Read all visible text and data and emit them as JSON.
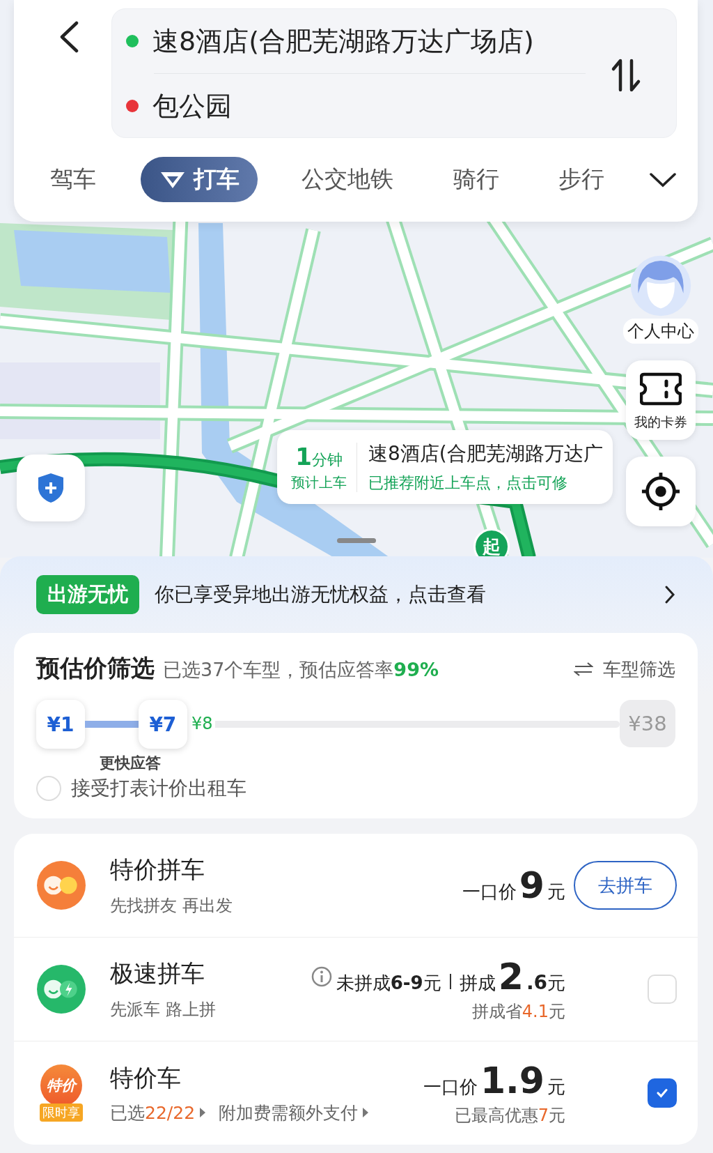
{
  "route": {
    "origin": "速8酒店(合肥芜湖路万达广场店)",
    "destination": "包公园"
  },
  "modes": [
    {
      "label": "驾车",
      "selected": false
    },
    {
      "label": "打车",
      "selected": true
    },
    {
      "label": "公交地铁",
      "selected": false
    },
    {
      "label": "骑行",
      "selected": false
    },
    {
      "label": "步行",
      "selected": false
    }
  ],
  "map": {
    "kind": "picture",
    "start_marker": "起",
    "side_buttons": [
      {
        "kind": "avatar",
        "label": "个人中心"
      },
      {
        "kind": "ticket",
        "label": "我的卡券"
      },
      {
        "kind": "locate"
      }
    ],
    "pickup": {
      "minutes": "1",
      "unit": "分钟",
      "caption": "预计上车",
      "place": "速8酒店(合肥芜湖路万达广",
      "hint": "已推荐附近上车点，点击可修"
    }
  },
  "banner": {
    "tag": "出游无忧",
    "text": "你已享受异地出游无忧权益，点击查看"
  },
  "price_filter": {
    "title": "预估价筛选",
    "summary": "已选37个车型，预估应答率",
    "rate": "99%",
    "filter_link": "车型筛选",
    "slider": {
      "low_label": "¥1",
      "high_label": "¥7",
      "next_label": "¥8",
      "max_label": "¥38",
      "level": 0.16,
      "hint": "更快应答"
    },
    "taxi": {
      "label": "接受打表计价出租车",
      "checked": false
    }
  },
  "options": [
    {
      "kind": "button",
      "title": "特价拼车",
      "subtitle": "先找拼友 再出发",
      "price_prefix": "一口价",
      "price": "9",
      "unit": "元",
      "action": "去拼车"
    },
    {
      "kind": "checkbox",
      "title": "极速拼车",
      "subtitle": "先派车 路上拼",
      "info": "未拼成**6-9**元",
      "price_prefix": "拼成",
      "price": "2",
      "price_decimal": ".6",
      "unit": "元",
      "savings": [
        {
          "text": "拼成省",
          "highlight": false
        },
        {
          "text": "4.1",
          "highlight": true
        },
        {
          "text": "元",
          "highlight": false
        }
      ],
      "checked": false
    },
    {
      "kind": "checkbox",
      "icon_text": "特价",
      "tag": "限时享",
      "title": "特价车",
      "links": [
        {
          "parts": [
            {
              "text": "已选",
              "highlight": false
            },
            {
              "text": "22/22",
              "highlight": true
            }
          ]
        },
        {
          "parts": [
            {
              "text": "附加费需额外支付",
              "highlight": false
            }
          ]
        }
      ],
      "price_prefix": "一口价",
      "price": "1.9",
      "unit": "元",
      "savings": [
        {
          "text": "已最高优惠",
          "highlight": false
        },
        {
          "text": "7",
          "highlight": true
        },
        {
          "text": "元",
          "highlight": false
        }
      ],
      "checked": true
    }
  ]
}
